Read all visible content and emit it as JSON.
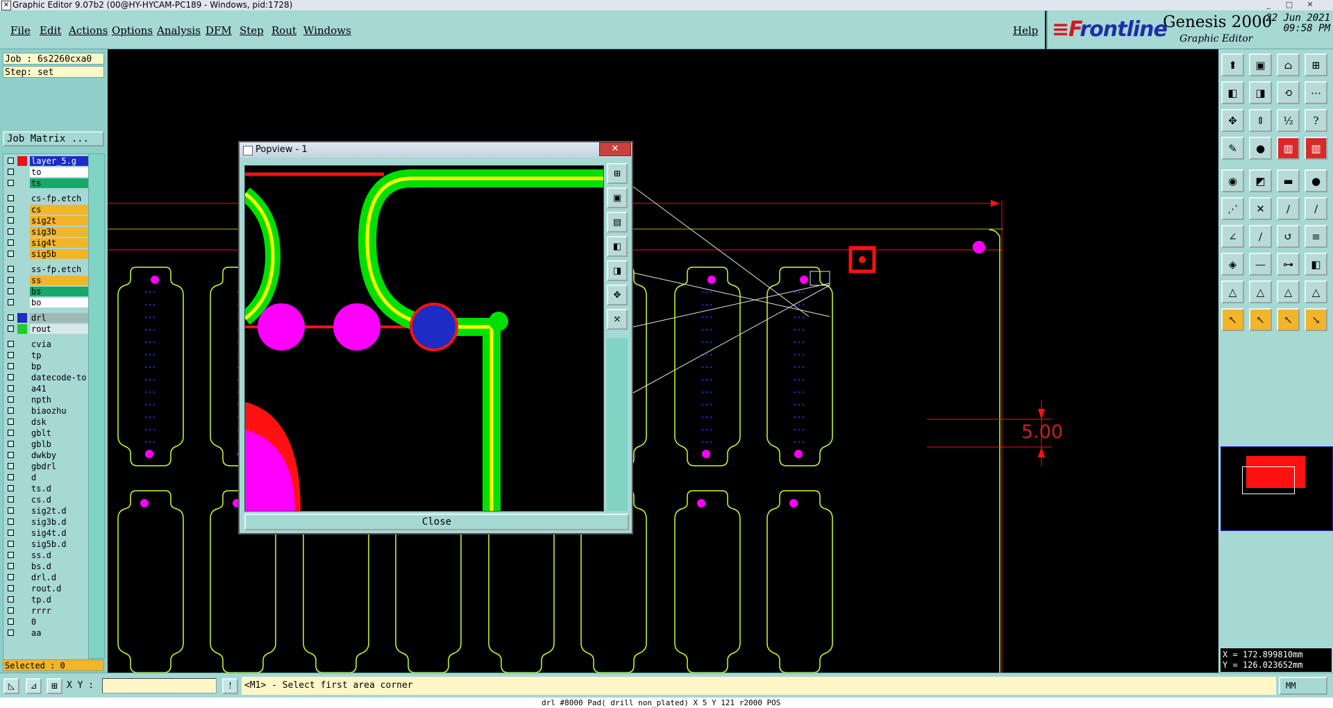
{
  "window": {
    "title": "Graphic Editor 9.07b2 (00@HY-HYCAM-PC189 - Windows, pid:1728)",
    "min": "_",
    "max": "□",
    "close": "✕"
  },
  "menu": {
    "file": "File",
    "edit": "Edit",
    "actions": "Actions",
    "options": "Options",
    "analysis": "Analysis",
    "dfm": "DFM",
    "step": "Step",
    "rout": "Rout",
    "windows": "Windows",
    "help": "Help"
  },
  "brand": {
    "logo_f": "≡F",
    "logo_rest": "rontline",
    "product": "Genesis 2000",
    "subtitle": "Graphic Editor",
    "date": "22 Jun 2021",
    "time": "09:58 PM"
  },
  "job": {
    "job_label": "Job : 6s2260cxa0",
    "step_label": "Step: set",
    "matrix_button": "Job Matrix ..."
  },
  "layers": [
    {
      "name": "layer_5.g",
      "bg": "#1d2cc4",
      "fg": "#ffffff",
      "swatch": "#e8121a",
      "active": true
    },
    {
      "name": "to",
      "bg": "#ffffff",
      "fg": "#000000",
      "swatch": "",
      "active": false
    },
    {
      "name": "ts",
      "bg": "#17a86a",
      "fg": "#000000",
      "swatch": "",
      "active": false
    },
    {
      "name": "cs-fp.etch",
      "bg": "#a6d8d4",
      "fg": "#000000",
      "swatch": "",
      "active": false
    },
    {
      "name": "cs",
      "bg": "#f2b428",
      "fg": "#000000",
      "swatch": "",
      "active": false
    },
    {
      "name": "sig2t",
      "bg": "#f2b428",
      "fg": "#000000",
      "swatch": "",
      "active": false
    },
    {
      "name": "sig3b",
      "bg": "#f2b428",
      "fg": "#000000",
      "swatch": "",
      "active": false
    },
    {
      "name": "sig4t",
      "bg": "#f2b428",
      "fg": "#000000",
      "swatch": "",
      "active": false
    },
    {
      "name": "sig5b",
      "bg": "#f2b428",
      "fg": "#000000",
      "swatch": "",
      "active": false
    },
    {
      "name": "ss-fp.etch",
      "bg": "#a6d8d4",
      "fg": "#000000",
      "swatch": "",
      "active": false
    },
    {
      "name": "ss",
      "bg": "#f2b428",
      "fg": "#000000",
      "swatch": "",
      "active": false
    },
    {
      "name": "bs",
      "bg": "#17a86a",
      "fg": "#000000",
      "swatch": "",
      "active": false
    },
    {
      "name": "bo",
      "bg": "#ffffff",
      "fg": "#000000",
      "swatch": "",
      "active": false
    },
    {
      "name": "drl",
      "bg": "#9fb9b7",
      "fg": "#000000",
      "swatch": "#1d2cc4",
      "active": false
    },
    {
      "name": "rout",
      "bg": "#d8e8e6",
      "fg": "#000000",
      "swatch": "#22cc22",
      "active": false
    },
    {
      "name": "cvia",
      "bg": "#a6d8d4",
      "fg": "#000000",
      "swatch": "",
      "active": false
    },
    {
      "name": "tp",
      "bg": "#a6d8d4",
      "fg": "#000000",
      "swatch": "",
      "active": false
    },
    {
      "name": "bp",
      "bg": "#a6d8d4",
      "fg": "#000000",
      "swatch": "",
      "active": false
    },
    {
      "name": "datecode-to",
      "bg": "#a6d8d4",
      "fg": "#000000",
      "swatch": "",
      "active": false
    },
    {
      "name": "a41",
      "bg": "#a6d8d4",
      "fg": "#000000",
      "swatch": "",
      "active": false
    },
    {
      "name": "npth",
      "bg": "#a6d8d4",
      "fg": "#000000",
      "swatch": "",
      "active": false
    },
    {
      "name": "biaozhu",
      "bg": "#a6d8d4",
      "fg": "#000000",
      "swatch": "",
      "active": false
    },
    {
      "name": "dsk",
      "bg": "#a6d8d4",
      "fg": "#000000",
      "swatch": "",
      "active": false
    },
    {
      "name": "gblt",
      "bg": "#a6d8d4",
      "fg": "#000000",
      "swatch": "",
      "active": false
    },
    {
      "name": "gblb",
      "bg": "#a6d8d4",
      "fg": "#000000",
      "swatch": "",
      "active": false
    },
    {
      "name": "dwkby",
      "bg": "#a6d8d4",
      "fg": "#000000",
      "swatch": "",
      "active": false
    },
    {
      "name": "gbdrl",
      "bg": "#a6d8d4",
      "fg": "#000000",
      "swatch": "",
      "active": false
    },
    {
      "name": "d",
      "bg": "#a6d8d4",
      "fg": "#000000",
      "swatch": "",
      "active": false
    },
    {
      "name": "ts.d",
      "bg": "#a6d8d4",
      "fg": "#000000",
      "swatch": "",
      "active": false
    },
    {
      "name": "cs.d",
      "bg": "#a6d8d4",
      "fg": "#000000",
      "swatch": "",
      "active": false
    },
    {
      "name": "sig2t.d",
      "bg": "#a6d8d4",
      "fg": "#000000",
      "swatch": "",
      "active": false
    },
    {
      "name": "sig3b.d",
      "bg": "#a6d8d4",
      "fg": "#000000",
      "swatch": "",
      "active": false
    },
    {
      "name": "sig4t.d",
      "bg": "#a6d8d4",
      "fg": "#000000",
      "swatch": "",
      "active": false
    },
    {
      "name": "sig5b.d",
      "bg": "#a6d8d4",
      "fg": "#000000",
      "swatch": "",
      "active": false
    },
    {
      "name": "ss.d",
      "bg": "#a6d8d4",
      "fg": "#000000",
      "swatch": "",
      "active": false
    },
    {
      "name": "bs.d",
      "bg": "#a6d8d4",
      "fg": "#000000",
      "swatch": "",
      "active": false
    },
    {
      "name": "drl.d",
      "bg": "#a6d8d4",
      "fg": "#000000",
      "swatch": "",
      "active": false
    },
    {
      "name": "rout.d",
      "bg": "#a6d8d4",
      "fg": "#000000",
      "swatch": "",
      "active": false
    },
    {
      "name": "tp.d",
      "bg": "#a6d8d4",
      "fg": "#000000",
      "swatch": "",
      "active": false
    },
    {
      "name": "rrrr",
      "bg": "#a6d8d4",
      "fg": "#000000",
      "swatch": "",
      "active": false
    },
    {
      "name": "0",
      "bg": "#a6d8d4",
      "fg": "#000000",
      "swatch": "",
      "active": false
    },
    {
      "name": "aa",
      "bg": "#a6d8d4",
      "fg": "#000000",
      "swatch": "",
      "active": false
    }
  ],
  "selected": "Selected : 0",
  "popup": {
    "title": "Popview - 1",
    "close_label": "Close"
  },
  "canvas": {
    "dimension": "5.00"
  },
  "coords": {
    "x": "X = 172.899810mm",
    "y": "Y = 126.023652mm"
  },
  "bottom": {
    "xy_label": "X Y :",
    "xy_value": "",
    "prompt": "<M1> - Select first area corner",
    "units": "MM"
  },
  "status_line": "drl #8000 Pad( drill non_plated) X 5 Y 121 r2000 POS",
  "colors": {
    "panel": "#a6d8d4",
    "outline": "#ccff33",
    "pad": "#ff00ff",
    "route": "#00e000",
    "red": "#ff1111",
    "blue": "#1d2cc4"
  }
}
